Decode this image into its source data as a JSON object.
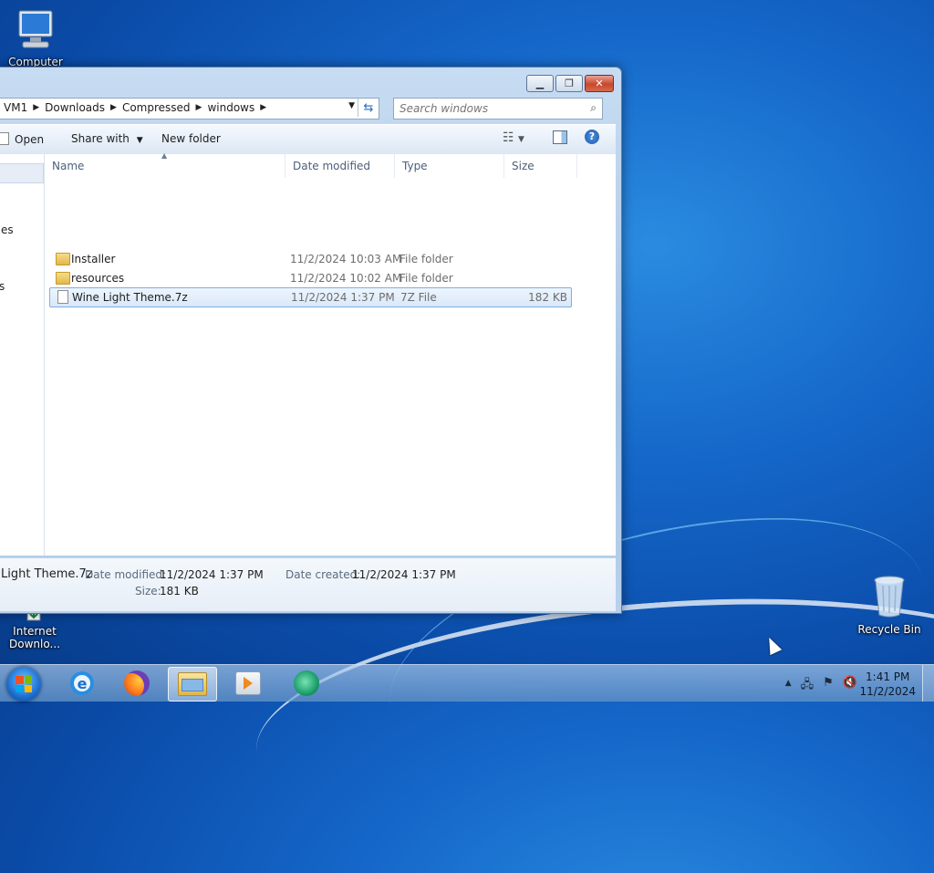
{
  "desktop": {
    "icons": [
      {
        "label": "Computer"
      },
      {
        "label": "Internet Downlo..."
      },
      {
        "label": "Recycle Bin"
      }
    ]
  },
  "window": {
    "address": {
      "crumbs": [
        "VM1",
        "Downloads",
        "Compressed",
        "windows"
      ]
    },
    "search": {
      "placeholder": "Search windows"
    },
    "toolbar": {
      "open": "Open",
      "share_with": "Share with",
      "new_folder": "New folder"
    },
    "nav_fragments": [
      "es",
      "s"
    ],
    "columns": {
      "name": "Name",
      "date_modified": "Date modified",
      "type": "Type",
      "size": "Size"
    },
    "files": [
      {
        "name": "Installer",
        "date": "11/2/2024 10:03 AM",
        "type": "File folder",
        "size": "",
        "kind": "folder"
      },
      {
        "name": "resources",
        "date": "11/2/2024 10:02 AM",
        "type": "File folder",
        "size": "",
        "kind": "folder"
      },
      {
        "name": "Wine Light Theme.7z",
        "date": "11/2/2024 1:37 PM",
        "type": "7Z File",
        "size": "182 KB",
        "kind": "file",
        "selected": true
      }
    ],
    "details": {
      "filename": "Light Theme.7z",
      "date_modified_label": "Date modified:",
      "date_modified": "11/2/2024 1:37 PM",
      "date_created_label": "Date created:",
      "date_created": "11/2/2024 1:37 PM",
      "size_label": "Size:",
      "size": "181 KB"
    }
  },
  "taskbar": {
    "apps": [
      "internet-explorer",
      "firefox",
      "windows-explorer",
      "windows-media-player",
      "internet-download-manager"
    ],
    "active_app": "windows-explorer",
    "clock": {
      "time": "1:41 PM",
      "date": "11/2/2024"
    }
  }
}
